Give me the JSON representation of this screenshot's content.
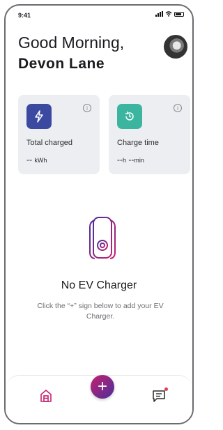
{
  "status_bar": {
    "time": "9:41"
  },
  "header": {
    "greeting": "Good Morning,",
    "name": "Devon Lane"
  },
  "cards": [
    {
      "label": "Total charged",
      "value": "--",
      "unit": "kWh",
      "icon": "lightning-icon",
      "color": "#3b4aa0"
    },
    {
      "label": "Charge time",
      "hours": "--",
      "hours_unit": "h",
      "minutes": "--",
      "minutes_unit": "min",
      "icon": "clock-rotate-icon",
      "color": "#3bb59f"
    }
  ],
  "empty_state": {
    "title": "No EV Charger",
    "description": "Click the “+” sign below to add your EV Charger."
  },
  "tabbar": {
    "home_icon": "home-icon",
    "add_icon": "plus-icon",
    "messages_icon": "message-icon",
    "accent": "#c5216e"
  },
  "colors": {
    "accent": "#c5216e",
    "secondary": "#4b2e9c"
  }
}
